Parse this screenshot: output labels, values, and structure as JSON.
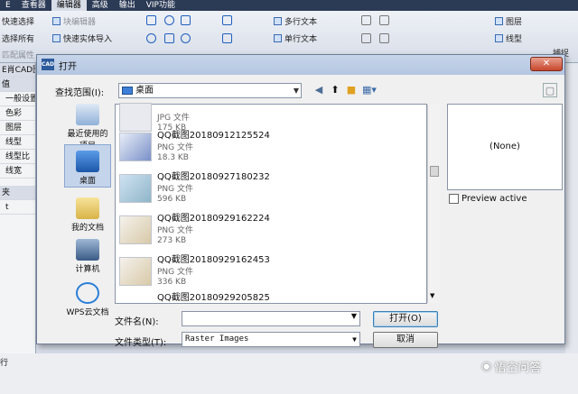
{
  "menu": {
    "tabs": [
      "E",
      "查看器",
      "编辑器",
      "高级",
      "输出",
      "VIP功能"
    ],
    "active_index": 2
  },
  "ribbon": {
    "left": [
      "快速选择",
      "选择所有",
      "匹配属性"
    ],
    "mid": [
      "块编辑器",
      "快速实体导入"
    ],
    "text": [
      "多行文本",
      "单行文本"
    ],
    "right": [
      "图层",
      "线型"
    ],
    "logo": "捕捉"
  },
  "left_panel": {
    "items": [
      "E肖CAD图",
      "值",
      "一般设置",
      "色彩",
      "图层",
      "线型",
      "线型比",
      "线宽",
      "夹",
      "t"
    ]
  },
  "status": {
    "text": "行"
  },
  "dialog": {
    "title": "打开",
    "close": "✕",
    "look_in_label": "查找范围(I):",
    "look_in_value": "桌面",
    "places": [
      {
        "label": "最近使用的项目"
      },
      {
        "label": "桌面"
      },
      {
        "label": "我的文档"
      },
      {
        "label": "计算机"
      },
      {
        "label": "WPS云文档"
      }
    ],
    "files": [
      {
        "name": "",
        "type": "JPG 文件",
        "size": "175 KB"
      },
      {
        "name": "QQ截图20180912125524",
        "type": "PNG 文件",
        "size": "18.3 KB"
      },
      {
        "name": "QQ截图20180927180232",
        "type": "PNG 文件",
        "size": "596 KB"
      },
      {
        "name": "QQ截图20180929162224",
        "type": "PNG 文件",
        "size": "273 KB"
      },
      {
        "name": "QQ截图20180929162453",
        "type": "PNG 文件",
        "size": "336 KB"
      },
      {
        "name": "QQ截图20180929205825",
        "type": "",
        "size": ""
      }
    ],
    "preview_text": "(None)",
    "preview_active_label": "Preview active",
    "filename_label": "文件名(N):",
    "filename_value": "",
    "filetype_label": "文件类型(T):",
    "filetype_value": "Raster Images",
    "open_button": "打开(O)",
    "cancel_button": "取消"
  },
  "watermark": "悟空问答"
}
